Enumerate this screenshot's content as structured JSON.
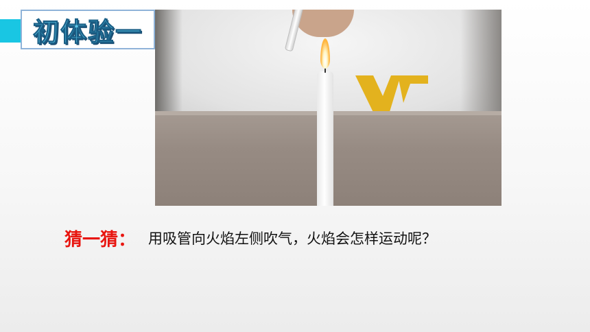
{
  "title": "初体验一",
  "photo": {
    "subject": "candle-flame-straw-photo"
  },
  "prompt": {
    "label": "猜一猜：",
    "question": "用吸管向火焰左侧吹气，火焰会怎样运动呢？"
  },
  "colors": {
    "accent": "#19c6e3",
    "title_fill": "#5ec8ea",
    "label_red": "#e8150f"
  }
}
